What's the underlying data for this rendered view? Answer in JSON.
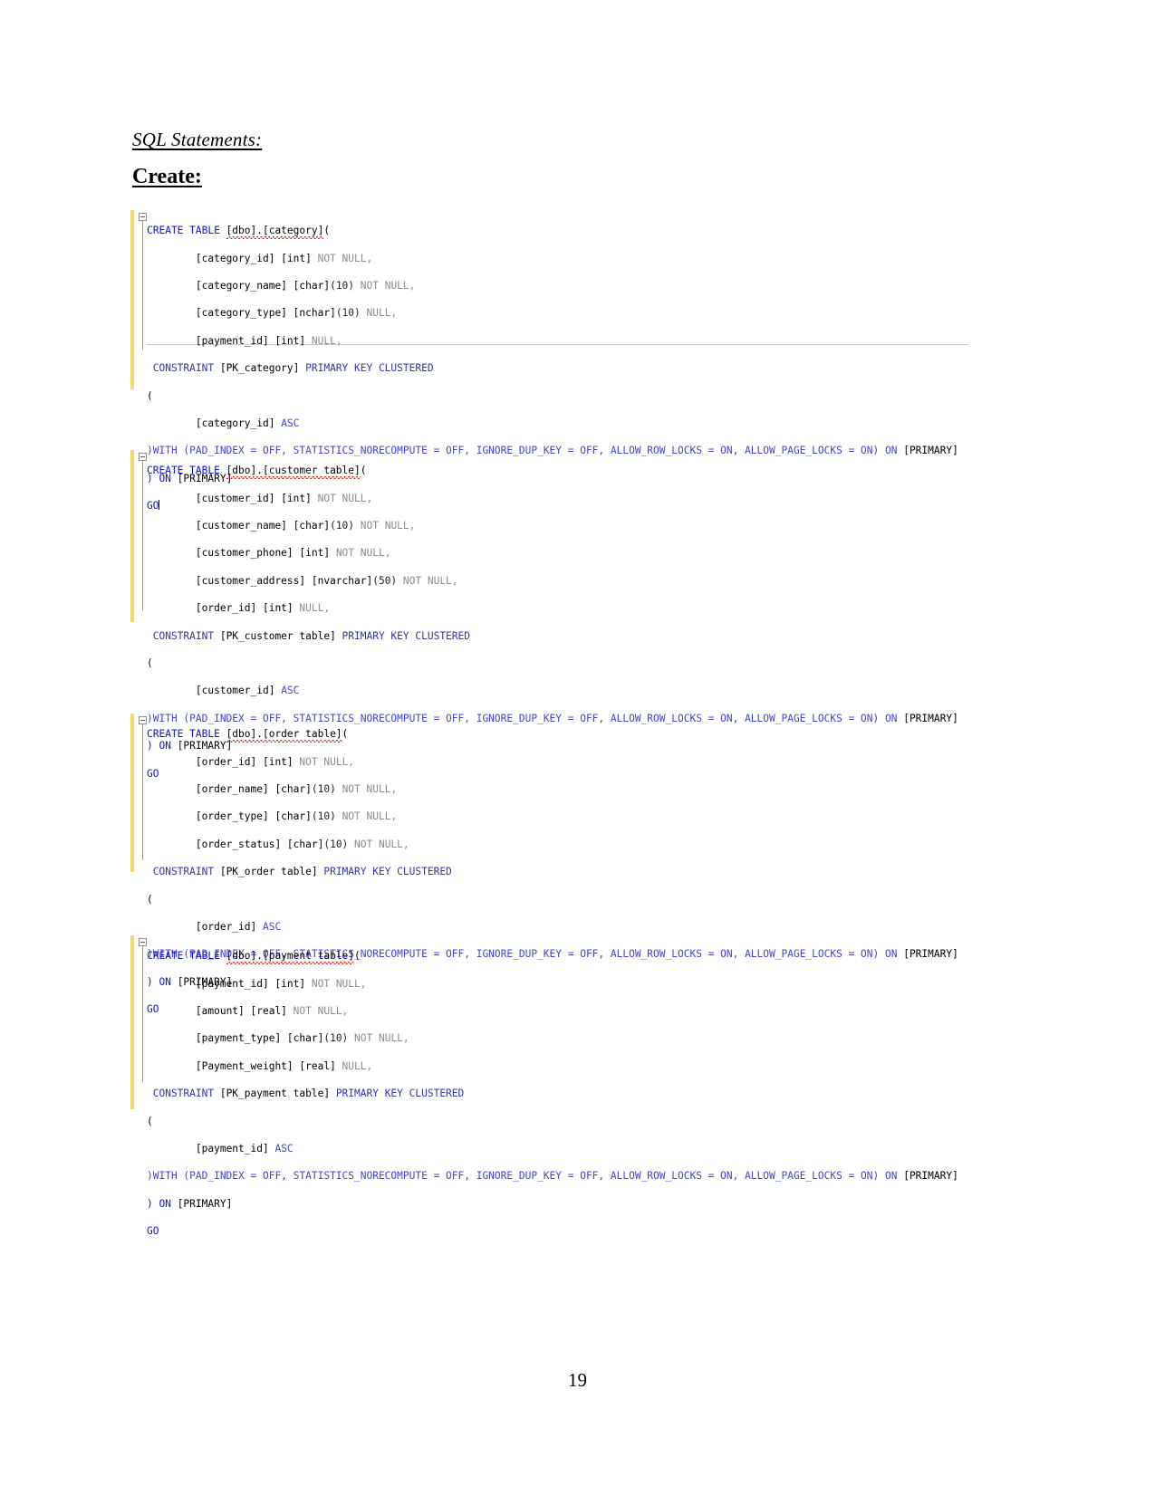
{
  "document": {
    "headings": {
      "sql_statements": "SQL Statements:",
      "create": "Create:"
    },
    "page_number": "19"
  },
  "colors": {
    "keyword": "#1111CC",
    "keyword_constraint": "#3333AA",
    "option": "#4444CC",
    "value": "#4444CC",
    "null_keyword": "#8C8C8C",
    "identifier": "#000000",
    "edit_bar": "#F0DC6E",
    "spellcheck_underline": "#D02020",
    "guide_line": "#9A9A9A",
    "separator_rule": "#C8C8C8"
  },
  "code_blocks": [
    {
      "id": "create-category",
      "table": "[dbo].[category]",
      "lines": {
        "l1_create": "CREATE TABLE ",
        "l1_table": "[dbo].[category]",
        "l1_paren": "(",
        "l2_col": "\t[category_id] [int] ",
        "l2_null": "NOT NULL,",
        "l3_col": "\t[category_name] [char]",
        "l3_size": "(10)",
        "l3_null": " NOT NULL,",
        "l4_col": "\t[category_type] [nchar]",
        "l4_size": "(10)",
        "l4_null": " NULL,",
        "l5_col": "\t[payment_id] [int] ",
        "l5_null": "NULL,",
        "l6_constraint": " CONSTRAINT ",
        "l6_pk": "[PK_category] ",
        "l6_kw": "PRIMARY KEY CLUSTERED",
        "l7_paren": "(",
        "l8_col": "\t[category_id] ",
        "l8_asc": "ASC",
        "l9_with": ")WITH (PAD_INDEX = OFF, STATISTICS_NORECOMPUTE = OFF, IGNORE_DUP_KEY = OFF, ALLOW_ROW_LOCKS = ON, ALLOW_PAGE_LOCKS = ON) ON ",
        "l9_primary": "[PRIMARY]",
        "l10_on": ") ON ",
        "l10_primary": "[PRIMARY]",
        "l11_go": "GO"
      }
    },
    {
      "id": "create-customer-table",
      "table": "[dbo].[customer table]",
      "lines": {
        "l1_create": "CREATE TABLE ",
        "l1_table": "[dbo].[customer table]",
        "l1_paren": "(",
        "l2_col": "\t[customer_id] [int] ",
        "l2_null": "NOT NULL,",
        "l3_col": "\t[customer_name] [char]",
        "l3_size": "(10)",
        "l3_null": " NOT NULL,",
        "l4_col": "\t[customer_phone] [int] ",
        "l4_null": "NOT NULL,",
        "l5_col": "\t[customer_address] [nvarchar]",
        "l5_size": "(50)",
        "l5_null": " NOT NULL,",
        "l6_col": "\t[order_id] [int] ",
        "l6_null": "NULL,",
        "l7_constraint": " CONSTRAINT ",
        "l7_pk": "[PK_customer table] ",
        "l7_kw": "PRIMARY KEY CLUSTERED",
        "l8_paren": "(",
        "l9_col": "\t[customer_id] ",
        "l9_asc": "ASC",
        "l10_with": ")WITH (PAD_INDEX = OFF, STATISTICS_NORECOMPUTE = OFF, IGNORE_DUP_KEY = OFF, ALLOW_ROW_LOCKS = ON, ALLOW_PAGE_LOCKS = ON) ON ",
        "l10_primary": "[PRIMARY]",
        "l11_on": ") ON ",
        "l11_primary": "[PRIMARY]",
        "l12_go": "GO"
      }
    },
    {
      "id": "create-order-table",
      "table": "[dbo].[order table]",
      "lines": {
        "l1_create": "CREATE TABLE ",
        "l1_table": "[dbo].[order table]",
        "l1_paren": "(",
        "l2_col": "\t[order_id] [int] ",
        "l2_null": "NOT NULL,",
        "l3_col": "\t[order_name] [char]",
        "l3_size": "(10)",
        "l3_null": " NOT NULL,",
        "l4_col": "\t[order_type] [char]",
        "l4_size": "(10)",
        "l4_null": " NOT NULL,",
        "l5_col": "\t[order_status] [char]",
        "l5_size": "(10)",
        "l5_null": " NOT NULL,",
        "l6_constraint": " CONSTRAINT ",
        "l6_pk": "[PK_order table] ",
        "l6_kw": "PRIMARY KEY CLUSTERED",
        "l7_paren": "(",
        "l8_col": "\t[order_id] ",
        "l8_asc": "ASC",
        "l9_with": ")WITH (PAD_INDEX = OFF, STATISTICS_NORECOMPUTE = OFF, IGNORE_DUP_KEY = OFF, ALLOW_ROW_LOCKS = ON, ALLOW_PAGE_LOCKS = ON) ON ",
        "l9_primary": "[PRIMARY]",
        "l10_on": ") ON ",
        "l10_primary": "[PRIMARY]",
        "l11_go": "GO"
      }
    },
    {
      "id": "create-payment-table",
      "table": "[dbo].[payment table]",
      "lines": {
        "l1_create": "CREATE TABLE ",
        "l1_table": "[dbo].[payment table]",
        "l1_paren": "(",
        "l2_col": "\t[payment_id] [int] ",
        "l2_null": "NOT NULL,",
        "l3_col": "\t[amount] [real] ",
        "l3_null": "NOT NULL,",
        "l4_col": "\t[payment_type] [char]",
        "l4_size": "(10)",
        "l4_null": " NOT NULL,",
        "l5_col": "\t[Payment_weight] [real] ",
        "l5_null": "NULL,",
        "l6_constraint": " CONSTRAINT ",
        "l6_pk": "[PK_payment table] ",
        "l6_kw": "PRIMARY KEY CLUSTERED",
        "l7_paren": "(",
        "l8_col": "\t[payment_id] ",
        "l8_asc": "ASC",
        "l9_with": ")WITH (PAD_INDEX = OFF, STATISTICS_NORECOMPUTE = OFF, IGNORE_DUP_KEY = OFF, ALLOW_ROW_LOCKS = ON, ALLOW_PAGE_LOCKS = ON) ON ",
        "l9_primary": "[PRIMARY]",
        "l10_on": ") ON ",
        "l10_primary": "[PRIMARY]",
        "l11_go": "GO"
      }
    }
  ]
}
